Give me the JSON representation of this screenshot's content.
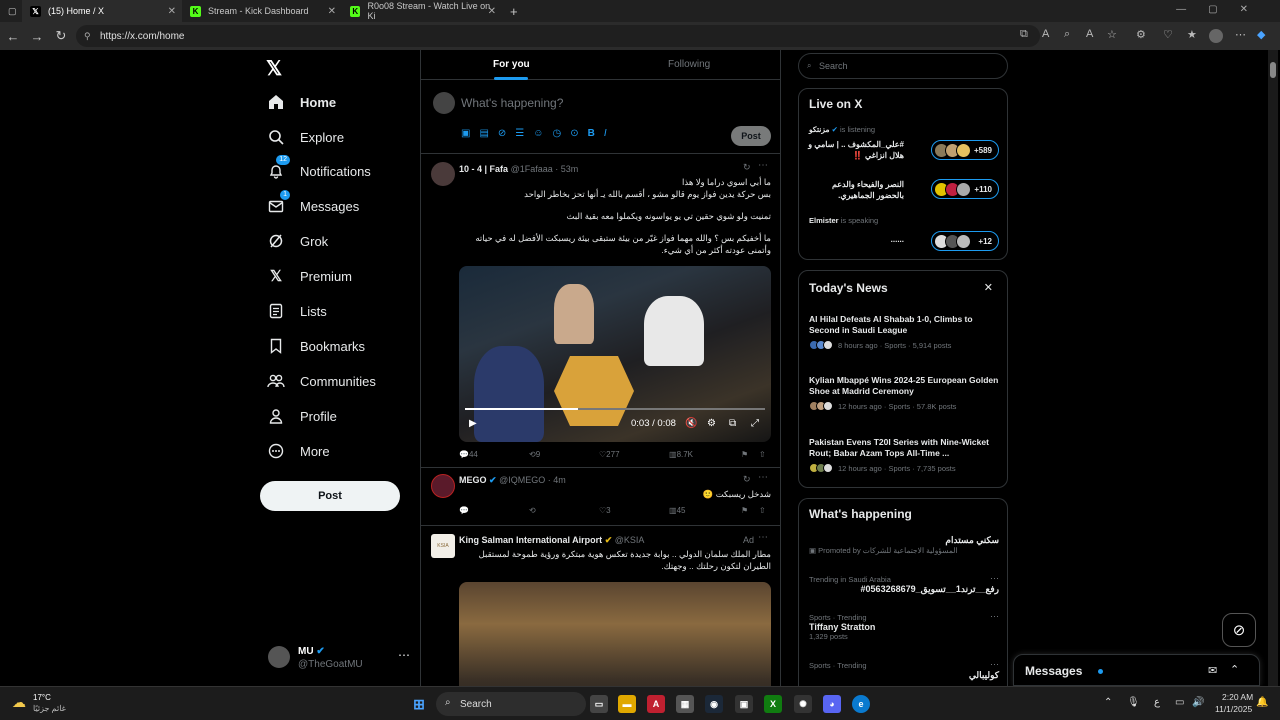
{
  "browser": {
    "tabs": [
      {
        "title": "(15) Home / X",
        "icon": "x-logo-icon"
      },
      {
        "title": "Stream - Kick Dashboard",
        "icon": "kick-logo-icon"
      },
      {
        "title": "R0o08 Stream - Watch Live on Ki",
        "icon": "kick-logo-icon"
      }
    ],
    "url": "https://x.com/home"
  },
  "nav": {
    "items": [
      {
        "label": "Home",
        "icon": "home-icon"
      },
      {
        "label": "Explore",
        "icon": "search-icon"
      },
      {
        "label": "Notifications",
        "icon": "bell-icon",
        "badge": "12"
      },
      {
        "label": "Messages",
        "icon": "envelope-icon",
        "badge": "1"
      },
      {
        "label": "Grok",
        "icon": "grok-icon"
      },
      {
        "label": "Premium",
        "icon": "x-icon"
      },
      {
        "label": "Lists",
        "icon": "list-icon"
      },
      {
        "label": "Bookmarks",
        "icon": "bookmark-icon"
      },
      {
        "label": "Communities",
        "icon": "people-icon"
      },
      {
        "label": "Profile",
        "icon": "person-icon"
      },
      {
        "label": "More",
        "icon": "more-circle-icon"
      }
    ],
    "post_label": "Post",
    "user": {
      "name": "MU",
      "handle": "@TheGoatMU"
    }
  },
  "feed": {
    "tabs": [
      "For you",
      "Following"
    ],
    "compose_placeholder": "What's happening?",
    "post_label": "Post",
    "tweets": [
      {
        "name": "10 - 4 | Fafa",
        "handle": "@1Fafaaa",
        "time": "· 53m",
        "lines": [
          "ما أبي اسوي دراما ولا هذا",
          "بس حركة يدين فواز يوم قالو مشو ، أقسم بالله يـ أنها تحز بخاطر الواحد",
          "",
          "تمنيت ولو شوي حقين تي يو يواسونه ويكملوا معه بقية البث",
          "",
          "ما أخفيكم بس ؟ والله مهما فواز غيّر من بيئة ستبقى بيئة ريسبكت الأفضل له في حياته",
          "وأتمنى عودته أكثر من أي شيء."
        ],
        "video_time": "0:03 / 0:08",
        "video_progress": 0.375,
        "replies": "44",
        "retweets": "9",
        "likes": "277",
        "views": "8.7K"
      },
      {
        "name": "MEGO",
        "handle": "@IQMEGO",
        "time": "· 4m",
        "text": "شدخل ريسبكت 🙂",
        "replies": "",
        "retweets": "",
        "likes": "3",
        "views": "45"
      },
      {
        "name": "King Salman International Airport",
        "handle": "@KSIA",
        "tag": "Ad",
        "lines": [
          "مطار الملك سلمان الدولي .. بوابة جديدة تعكس هوية مبتكرة ورؤية طموحة لمستقبل",
          "الطيران لتكون رحلتك .. وجهتك."
        ]
      }
    ]
  },
  "sidebar": {
    "search_placeholder": "Search",
    "live": {
      "title": "Live on X",
      "items": [
        {
          "host": "مزنتكو",
          "status": "is listening",
          "title": "#علي_المكشوف .. | سامي و هلال انزاغي ‼️",
          "count": "+589"
        },
        {
          "host": "",
          "status": "",
          "title": "النصر والفيحاء والدعم بالحضور الجماهيري.",
          "count": "+110"
        },
        {
          "host": "Elmister",
          "status": "is speaking",
          "title": "......",
          "count": "+12"
        }
      ]
    },
    "news": {
      "title": "Today's News",
      "items": [
        {
          "headline": "Al Hilal Defeats Al Shabab 1-0, Climbs to Second in Saudi League",
          "meta": "8 hours ago · Sports · 5,914 posts"
        },
        {
          "headline": "Kylian Mbappé Wins 2024-25 European Golden Shoe at Madrid Ceremony",
          "meta": "12 hours ago · Sports · 57.8K posts"
        },
        {
          "headline": "Pakistan Evens T20I Series with Nine-Wicket Rout; Babar Azam Tops All-Time ...",
          "meta": "12 hours ago · Sports · 7,735 posts"
        }
      ]
    },
    "happening": {
      "title": "What's happening",
      "items": [
        {
          "context": "",
          "topic": "سكني مستدام",
          "sub": "المسؤولية الاجتماعية للشركات",
          "promoted": "Promoted by"
        },
        {
          "context": "Trending in Saudi Arabia",
          "topic": "#رفع__ترند1__تسويق_0563268679",
          "sub": ""
        },
        {
          "context": "Sports · Trending",
          "topic": "Tiffany Stratton",
          "sub": "1,329 posts"
        },
        {
          "context": "Sports · Trending",
          "topic": "كوليبالي",
          "sub": ""
        }
      ]
    },
    "messages_title": "Messages"
  },
  "taskbar": {
    "weather_temp": "17°C",
    "weather_text": "غائم جزئيًا",
    "search_label": "Search",
    "time": "2:20 AM",
    "date": "11/1/2025",
    "lang": "ع"
  },
  "colors": {
    "accent": "#1d9bf0",
    "bg": "#000000",
    "border": "#2f3336",
    "muted": "#71767b"
  }
}
